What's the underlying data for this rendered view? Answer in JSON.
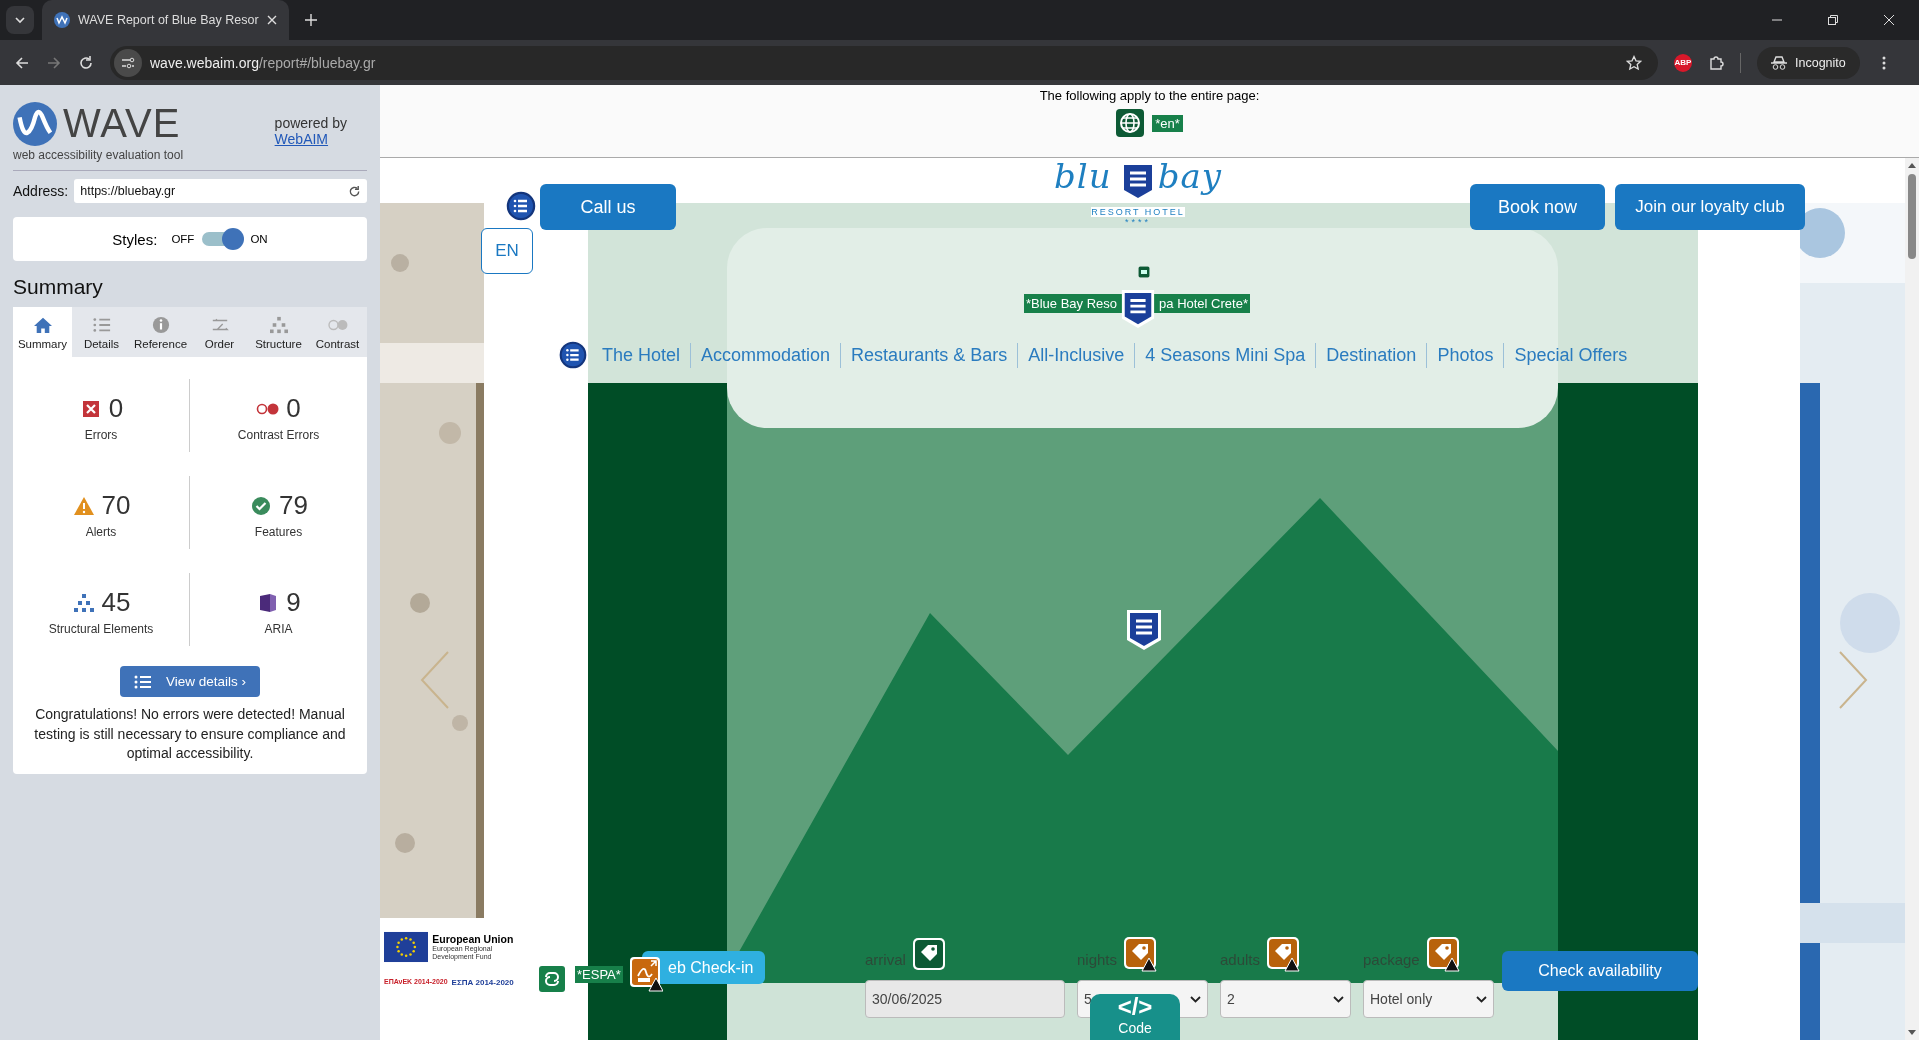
{
  "browser": {
    "tab_title": "WAVE Report of Blue Bay Resor",
    "url_host": "wave.webaim.org",
    "url_path": "/report#/bluebay.gr",
    "extension_badge": "ABP",
    "profile": "Incognito"
  },
  "wave": {
    "logo": "WAVE",
    "tagline": "web accessibility evaluation tool",
    "powered_by": "powered by",
    "link": "WebAIM",
    "address_label": "Address:",
    "address_value": "https://bluebay.gr",
    "styles_label": "Styles:",
    "styles_off": "OFF",
    "styles_on": "ON",
    "styles_enabled": true,
    "summary_heading": "Summary",
    "tabs": [
      {
        "kind": "home",
        "label": "Summary",
        "selected": true
      },
      {
        "kind": "details",
        "label": "Details",
        "selected": false
      },
      {
        "kind": "reference",
        "label": "Reference",
        "selected": false
      },
      {
        "kind": "order",
        "label": "Order",
        "selected": false
      },
      {
        "kind": "structure",
        "label": "Structure",
        "selected": false
      },
      {
        "kind": "contrast",
        "label": "Contrast",
        "selected": false
      }
    ],
    "stats": [
      {
        "kind": "errors",
        "value": "0",
        "label": "Errors"
      },
      {
        "kind": "contrast",
        "value": "0",
        "label": "Contrast Errors"
      },
      {
        "kind": "alerts",
        "value": "70",
        "label": "Alerts"
      },
      {
        "kind": "features",
        "value": "79",
        "label": "Features"
      },
      {
        "kind": "structure",
        "value": "45",
        "label": "Structural Elements"
      },
      {
        "kind": "aria",
        "value": "9",
        "label": "ARIA"
      }
    ],
    "view_details": "View details ›",
    "message": "Congratulations! No errors were detected! Manual testing is still necessary to ensure compliance and optimal accessibility."
  },
  "page_notice": {
    "text": "The following apply to the entire page:",
    "lang_label": "*en*"
  },
  "site": {
    "call_button": "Call us",
    "language": "EN",
    "logo_start": "blu",
    "logo_end": "bay",
    "logo_tagline": "RESORT HOTEL",
    "logo_stars": "****",
    "title_label_start": "*Blue Bay Reso",
    "title_label_end": "pa Hotel Crete*",
    "book_button": "Book now",
    "loyalty_button": "Join our loyalty club",
    "nav": [
      "The Hotel",
      "Accommodation",
      "Restaurants & Bars",
      "All-Inclusive",
      "4 Seasons Mini Spa",
      "Destination",
      "Photos",
      "Special Offers"
    ],
    "eu": {
      "title": "European Union",
      "subtitle": "European Regional Development Fund",
      "epanek": "ΕΠΑνΕΚ 2014-2020",
      "espa": "ΕΣΠΑ 2014-2020"
    },
    "espa_label": "*ESPA*",
    "checkin_button": "eb Check-in",
    "booking": [
      {
        "label": "arrival",
        "kind": "text",
        "warning": false,
        "value": "30/06/2025"
      },
      {
        "label": "nights",
        "kind": "select",
        "warning": true,
        "value": "5"
      },
      {
        "label": "adults",
        "kind": "select",
        "warning": true,
        "value": "2"
      },
      {
        "label": "package",
        "kind": "select",
        "warning": true,
        "value": "Hotel only"
      }
    ],
    "check_button": "Check availability",
    "code_tab": {
      "symbol": "</>",
      "label": "Code"
    }
  }
}
